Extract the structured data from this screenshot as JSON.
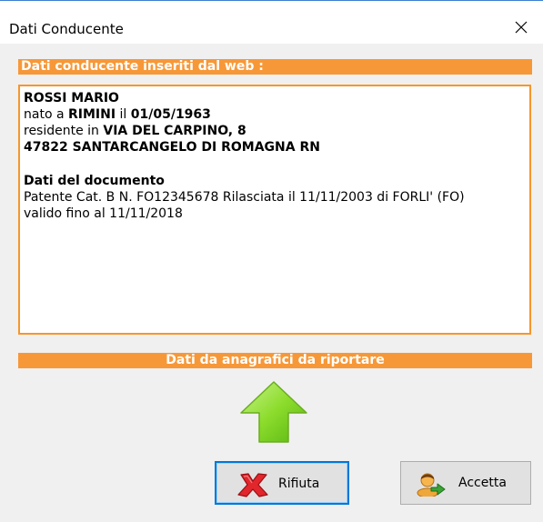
{
  "window": {
    "title": "Dati Conducente"
  },
  "header": {
    "label": "Dati conducente inseriti dal web :"
  },
  "driver": {
    "name": "ROSSI MARIO",
    "birth_prefix": "nato a ",
    "birth_city": "RIMINI",
    "birth_mid": " il ",
    "birth_date": "01/05/1963",
    "residence_prefix": "residente in ",
    "address": "VIA DEL CARPINO, 8",
    "city_line": "47822 SANTARCANGELO DI ROMAGNA RN"
  },
  "document": {
    "heading": "Dati del documento",
    "details": "Patente Cat. B N. FO12345678 Rilasciata il 11/11/2003 di FORLI' (FO) valido fino al 11/11/2018"
  },
  "section2": {
    "label": "Dati da anagrafici da riportare"
  },
  "buttons": {
    "reject_label": "Rifiuta",
    "accept_label": "Accetta"
  },
  "icons": {
    "close": "close-icon",
    "arrow": "up-arrow-icon",
    "reject": "red-x-icon",
    "accept": "user-accept-icon"
  },
  "colors": {
    "orange": "#f79838",
    "arrow_green": "#7ed31f",
    "focus_blue": "#0078d7",
    "reject_red": "#e1262c"
  }
}
